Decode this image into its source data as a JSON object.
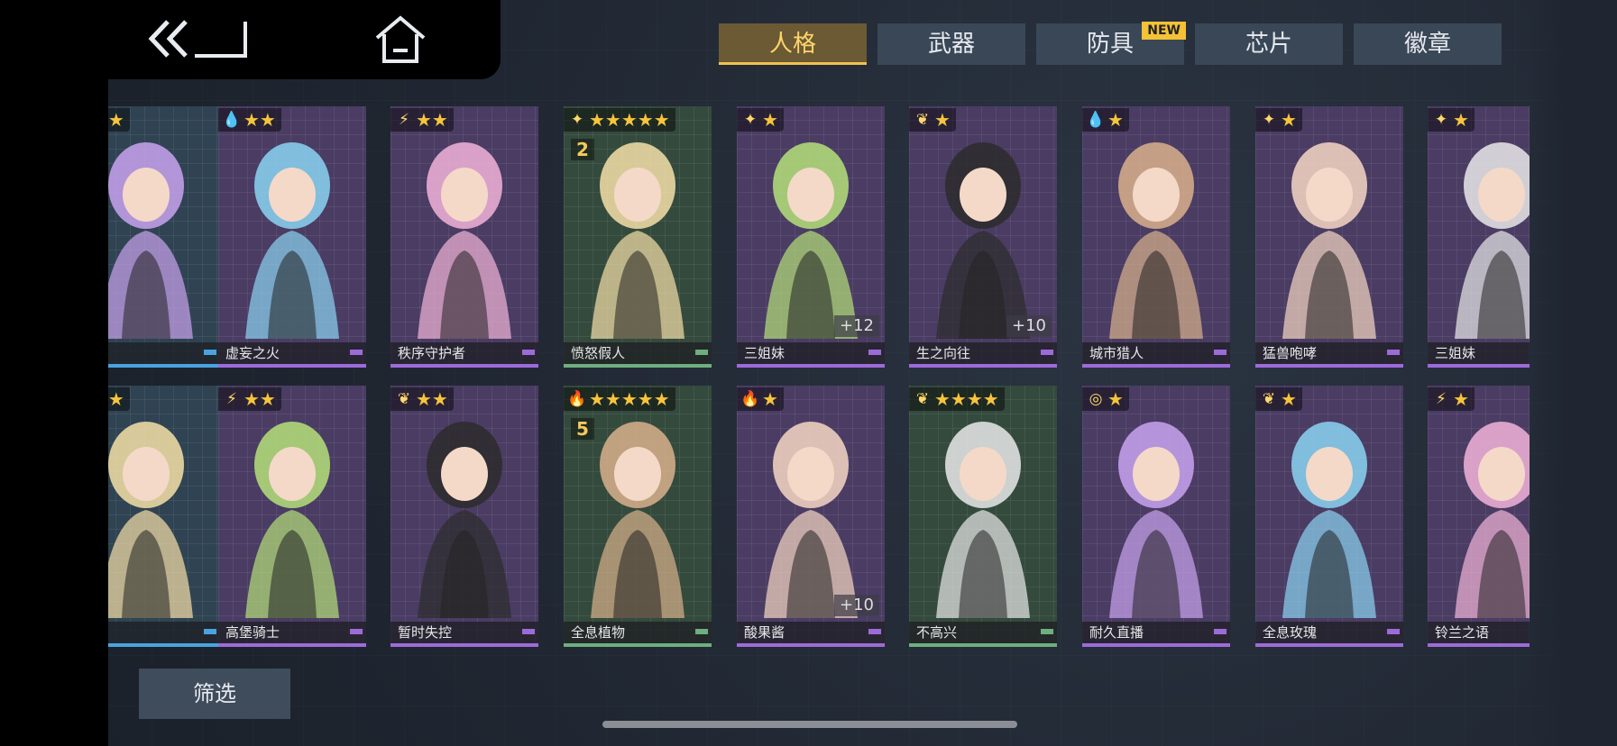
{
  "top_nav": {
    "back_icon": "double-chevron-back-icon",
    "home_icon": "home-icon"
  },
  "tabs": [
    {
      "label": "人格",
      "active": true
    },
    {
      "label": "武器",
      "active": false
    },
    {
      "label": "防具",
      "active": false,
      "badge": "NEW"
    },
    {
      "label": "芯片",
      "active": false
    },
    {
      "label": "徽章",
      "active": false
    }
  ],
  "cards_row1": [
    {
      "name": "",
      "stars": "★★★",
      "element": "",
      "theme": "blue"
    },
    {
      "name": "虚妄之火",
      "stars": "★★",
      "element": "💧",
      "theme": "purple"
    },
    {
      "name": "秩序守护者",
      "stars": "★★",
      "element": "⚡",
      "theme": "purple"
    },
    {
      "name": "愤怒假人",
      "stars": "★★★★★",
      "element": "✦",
      "theme": "green",
      "pips": "2"
    },
    {
      "name": "三姐妹",
      "stars": "★",
      "element": "✦",
      "theme": "purple",
      "plus": "+12"
    },
    {
      "name": "生之向往",
      "stars": "★",
      "element": "❦",
      "theme": "purple",
      "plus": "+10"
    },
    {
      "name": "城市猎人",
      "stars": "★",
      "element": "💧",
      "theme": "purple"
    },
    {
      "name": "猛兽咆哮",
      "stars": "★",
      "element": "✦",
      "theme": "purple"
    },
    {
      "name": "三姐妹",
      "stars": "★",
      "element": "✦",
      "theme": "purple"
    }
  ],
  "cards_row2": [
    {
      "name": "",
      "stars": "★★★",
      "element": "",
      "theme": "blue"
    },
    {
      "name": "高堡骑士",
      "stars": "★★",
      "element": "⚡",
      "theme": "purple"
    },
    {
      "name": "暂时失控",
      "stars": "★★",
      "element": "❦",
      "theme": "purple"
    },
    {
      "name": "全息植物",
      "stars": "★★★★★",
      "element": "🔥",
      "theme": "green",
      "pips": "5"
    },
    {
      "name": "酸果酱",
      "stars": "★",
      "element": "🔥",
      "theme": "purple",
      "plus": "+10"
    },
    {
      "name": "不高兴",
      "stars": "★★★★",
      "element": "❦",
      "theme": "green"
    },
    {
      "name": "耐久直播",
      "stars": "★",
      "element": "◎",
      "theme": "purple"
    },
    {
      "name": "全息玫瑰",
      "stars": "★",
      "element": "❦",
      "theme": "purple"
    },
    {
      "name": "铃兰之语",
      "stars": "★",
      "element": "⚡",
      "theme": "purple"
    }
  ],
  "filter": {
    "label": "筛选"
  },
  "colors": {
    "accent_gold": "#f2c14e",
    "star": "#f6c53b",
    "purple_rarity": "#9d6bd9",
    "green_rarity": "#6fae7f"
  }
}
